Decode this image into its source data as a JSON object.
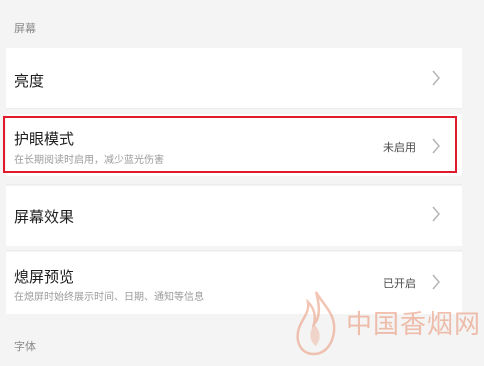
{
  "screen_section": {
    "title": "屏幕"
  },
  "rows": [
    {
      "title": "亮度",
      "subtitle": "",
      "value": ""
    },
    {
      "title": "护眼模式",
      "subtitle": "在长期阅读时启用，减少蓝光伤害",
      "value": "未启用"
    },
    {
      "title": "屏幕效果",
      "subtitle": "",
      "value": ""
    },
    {
      "title": "熄屏预览",
      "subtitle": "在熄屏时始终展示时间、日期、通知等信息",
      "value": "已开启"
    }
  ],
  "font_section": {
    "title": "字体"
  },
  "watermark": {
    "text": "中国香烟网",
    "color": "#e8a07e"
  },
  "colors": {
    "highlight": "#e01a2b",
    "background": "#f4f4f4"
  }
}
